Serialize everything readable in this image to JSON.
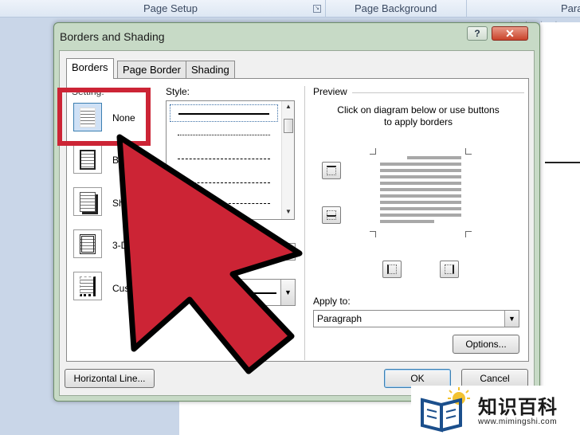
{
  "ribbon": {
    "groups": [
      "Page Setup",
      "Page Background",
      "Para"
    ]
  },
  "dialog": {
    "title": "Borders and Shading",
    "help_label": "?",
    "close_label": "x",
    "tabs": [
      "Borders",
      "Page Border",
      "Shading"
    ],
    "setting": {
      "label": "Setting:",
      "items": [
        "None",
        "Box",
        "Shadow",
        "3-D",
        "Custom"
      ],
      "visible_labels": [
        "None",
        "B",
        "Sh",
        "3-D",
        "Cust"
      ],
      "selected": "None"
    },
    "style": {
      "label": "Style:"
    },
    "preview": {
      "label": "Preview",
      "hint": "Click on diagram below or use buttons to apply borders"
    },
    "apply_to": {
      "label": "Apply to:",
      "value": "Paragraph"
    },
    "buttons": {
      "options": "Options...",
      "horizontal_line": "Horizontal Line...",
      "ok": "OK",
      "cancel": "Cancel"
    }
  },
  "overlay": {
    "annotation": "red arrow pointing at None setting",
    "highlight_color": "#cc2435"
  },
  "watermark": {
    "title": "知识百科",
    "url": "www.mimingshi.com"
  },
  "colors": {
    "dialog_frame": "#c7dac6",
    "accent_red": "#cc2435",
    "close_button": "#c9432a"
  }
}
